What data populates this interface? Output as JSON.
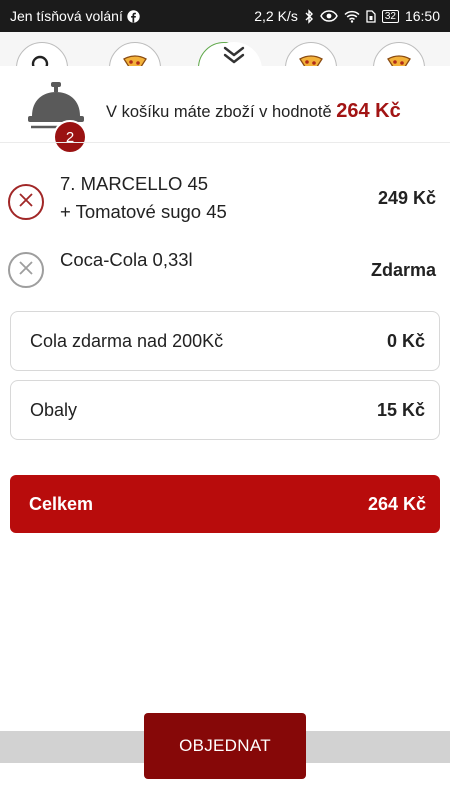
{
  "status_bar": {
    "carrier": "Jen tísňová volání",
    "speed": "2,2 K/s",
    "battery": "32",
    "time": "16:50"
  },
  "categories": [
    {
      "icon": "search-icon"
    },
    {
      "icon": "pizza-icon"
    },
    {
      "icon": "pizza-icon"
    },
    {
      "icon": "pizza-icon"
    },
    {
      "icon": "pizza-icon"
    }
  ],
  "cart": {
    "count": "2",
    "summary_text": "V košíku máte zboží v hodnotě",
    "summary_total": "264 Kč"
  },
  "items": [
    {
      "name_line1": "7. MARCELLO 45",
      "name_line2": "+ Tomatové sugo 45",
      "price": "249 Kč"
    },
    {
      "name_line1": "Coca-Cola 0,33l",
      "price": "Zdarma"
    }
  ],
  "extras": [
    {
      "label": "Cola zdarma nad 200Kč",
      "value": "0 Kč"
    },
    {
      "label": "Obaly",
      "value": "15 Kč"
    }
  ],
  "total": {
    "label": "Celkem",
    "value": "264 Kč"
  },
  "order_button": "OBJEDNAT",
  "colors": {
    "brand_red": "#b80c0c",
    "dark_red": "#860808",
    "badge_red": "#9a1212",
    "status_bar": "#1b1b1b"
  }
}
